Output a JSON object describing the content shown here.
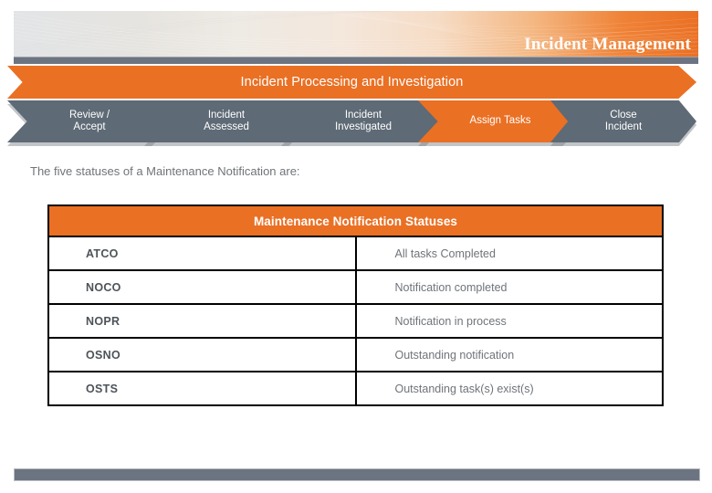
{
  "banner": {
    "title": "Incident Management",
    "accent_color": "#ea7024",
    "gray_color": "#6b7480"
  },
  "process_band": {
    "label": "Incident Processing and Investigation"
  },
  "process_steps": [
    {
      "label": "Review /\nAccept",
      "state": "gray"
    },
    {
      "label": "Incident\nAssessed",
      "state": "gray"
    },
    {
      "label": "Incident\nInvestigated",
      "state": "gray"
    },
    {
      "label": "Assign Tasks",
      "state": "orange"
    },
    {
      "label": "Close\nIncident",
      "state": "gray"
    }
  ],
  "intro_text": "The five statuses of a Maintenance Notification are:",
  "table": {
    "title": "Maintenance Notification Statuses",
    "rows": [
      {
        "code": "ATCO",
        "description": "All tasks Completed"
      },
      {
        "code": "NOCO",
        "description": "Notification completed"
      },
      {
        "code": "NOPR",
        "description": "Notification in process"
      },
      {
        "code": "OSNO",
        "description": "Outstanding notification"
      },
      {
        "code": "OSTS",
        "description": "Outstanding task(s) exist(s)"
      }
    ]
  }
}
